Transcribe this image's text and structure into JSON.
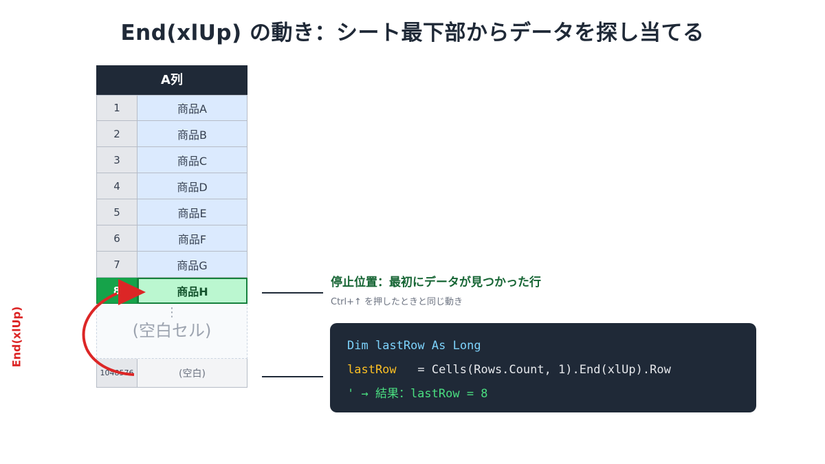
{
  "title": "End(xlUp) の動き：シート最下部からデータを探し当てる",
  "sheet": {
    "header": "A列",
    "rows": [
      {
        "num": "1",
        "value": "商品A"
      },
      {
        "num": "2",
        "value": "商品B"
      },
      {
        "num": "3",
        "value": "商品C"
      },
      {
        "num": "4",
        "value": "商品D"
      },
      {
        "num": "5",
        "value": "商品E"
      },
      {
        "num": "6",
        "value": "商品F"
      },
      {
        "num": "7",
        "value": "商品G"
      }
    ],
    "hit_row": {
      "num": "8",
      "value": "商品H"
    },
    "empty": {
      "dots": "⋮",
      "label": "(空白セル)"
    },
    "last_row": {
      "num": "1048576",
      "value": "(空白)"
    }
  },
  "stop": {
    "title": "停止位置：最初にデータが見つかった行",
    "subtitle": "Ctrl+↑ を押したときと同じ動き"
  },
  "code": {
    "line1": {
      "kw1": "Dim",
      "var": "lastRow",
      "kw2": "As",
      "kw3": "Long"
    },
    "line2": {
      "var": "lastRow",
      "expr": "   = Cells(Rows.Count, 1).End(xlUp).Row"
    },
    "line3": {
      "comment": "' → 結果：lastRow = 8"
    }
  },
  "side_label": "End(xlUp)",
  "colors": {
    "header_bg": "#1f2937",
    "data_cell": "#dbeafe",
    "hit_cell": "#bbf7d0",
    "hit_num": "#16a34a",
    "arrow": "#dc2626",
    "code_bg": "#1f2937",
    "keyword": "#7dd3fc",
    "variable": "#fbbf24",
    "comment": "#4ade80"
  }
}
